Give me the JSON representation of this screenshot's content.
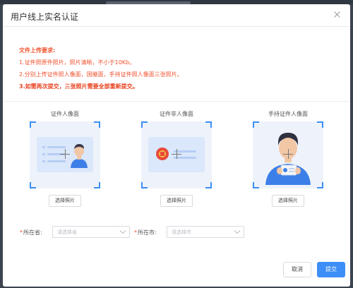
{
  "dialog": {
    "title": "用户线上实名认证"
  },
  "requirements": {
    "title": "文件上传要求:",
    "lines": [
      "1.证件照原件照片，照片清晰，不小于10Kb。",
      "2.分别上传证件照人像面，国徽面，手持证件照人像面三张照片。",
      "3.如需再次提交，三张照片需要全部重新提交。"
    ]
  },
  "cards": [
    {
      "label": "证件人像面",
      "button": "选择照片",
      "icon": "id-card-portrait-icon"
    },
    {
      "label": "证件非人像面",
      "button": "选择照片",
      "icon": "id-card-emblem-icon"
    },
    {
      "label": "手持证件人像面",
      "button": "选择照片",
      "icon": "person-holding-id-icon"
    }
  ],
  "form": {
    "province": {
      "label": "所在省:",
      "placeholder": "请选择省"
    },
    "city": {
      "label": "所在市:",
      "placeholder": "请选择市"
    }
  },
  "actions": {
    "cancel": "取消",
    "submit": "提交"
  },
  "colors": {
    "accent": "#3d8ef6",
    "warning_text": "#f0522e",
    "frame_bg": "#eef3fb"
  }
}
